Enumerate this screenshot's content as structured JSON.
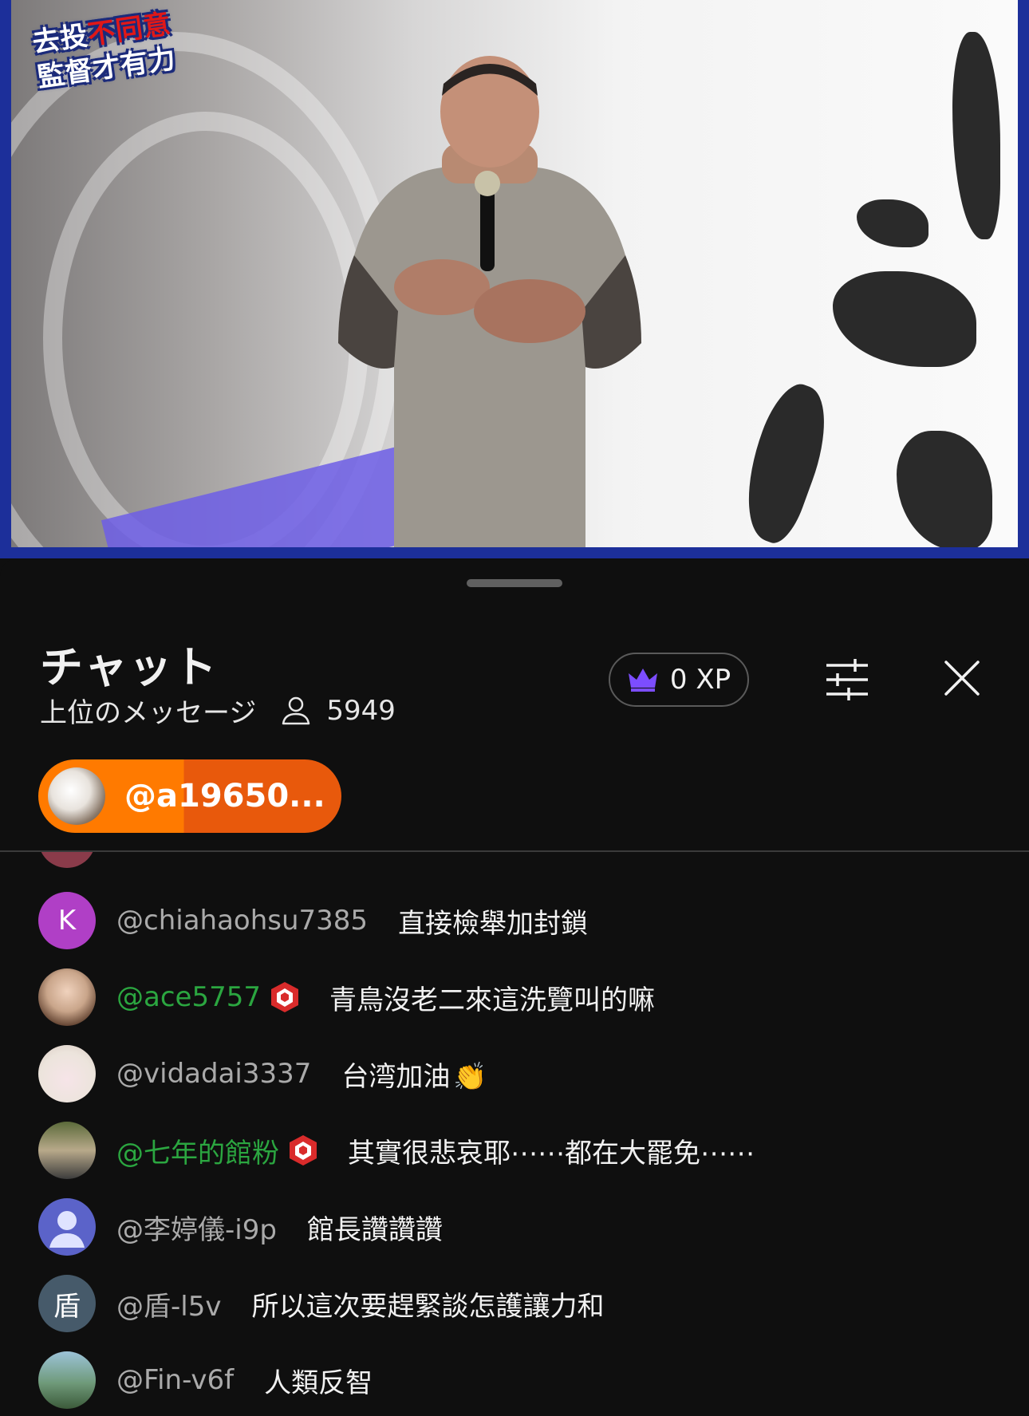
{
  "video": {
    "logo_line1_a": "去投",
    "logo_line1_b": "不同意",
    "logo_line2": "監督才有力"
  },
  "chat": {
    "title": "チャット",
    "mode": "上位のメッセージ",
    "viewer_count": "5949",
    "xp": "0 XP",
    "pinned_author": "@a19650...",
    "messages": [
      {
        "author": "@chiahaohsu7385",
        "text": "直接檢舉加封鎖",
        "avatar_letter": "K",
        "avatar_color": "#b03fc6",
        "member": false
      },
      {
        "author": "@ace5757",
        "text": "青鳥沒老二來這洗覽叫的嘛",
        "avatar_letter": "",
        "avatar_color": "#c9a58a",
        "member": true
      },
      {
        "author": "@vidadai3337",
        "text": "台湾加油",
        "emoji": "👏",
        "avatar_letter": "",
        "avatar_color": "#f4e8ea",
        "member": false
      },
      {
        "author": "@七年的館粉",
        "text": "其實很悲哀耶⋯⋯都在大罷免⋯⋯",
        "avatar_letter": "",
        "avatar_color": "#8a8f5a",
        "member": true
      },
      {
        "author": "@李婷儀-i9p",
        "text": "館長讚讚讚",
        "avatar_letter": "",
        "avatar_color": "#5b63c9",
        "member": false
      },
      {
        "author": "@盾-l5v",
        "text": "所以這次要趕緊談怎護讓力和",
        "avatar_letter": "盾",
        "avatar_color": "#465a6a",
        "member": false
      },
      {
        "author": "@Fin-v6f",
        "text": "人類反智",
        "avatar_letter": "",
        "avatar_color": "#6f9a7a",
        "member": false
      }
    ]
  },
  "colors": {
    "background": "#0f0f0f",
    "member_name": "#2ba640",
    "pinned_orange": "#ff7a00",
    "xp_crown": "#7c4dff"
  }
}
